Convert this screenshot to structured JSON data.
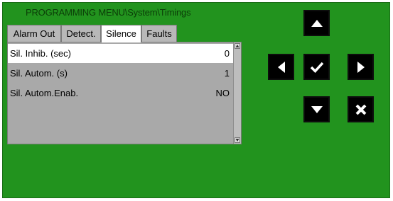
{
  "title": "PROGRAMMING MENU\\System\\Timings",
  "tabs": [
    {
      "label": "Alarm Out"
    },
    {
      "label": "Detect."
    },
    {
      "label": "Silence"
    },
    {
      "label": "Faults"
    }
  ],
  "active_tab": "Silence",
  "rows": [
    {
      "label": "Sil. Inhib. (sec)",
      "value": "0"
    },
    {
      "label": "Sil. Autom. (s)",
      "value": "1"
    },
    {
      "label": "Sil. Autom.Enab.",
      "value": "NO"
    }
  ],
  "buttons": {
    "up": "arrow-up-icon",
    "left": "arrow-left-icon",
    "ok": "check-icon",
    "right": "arrow-right-icon",
    "down": "arrow-down-icon",
    "cancel": "x-icon"
  },
  "colors": {
    "background": "#22931e",
    "button": "#000000",
    "list": "#a9a9a9",
    "selected_row": "#ffffff"
  }
}
